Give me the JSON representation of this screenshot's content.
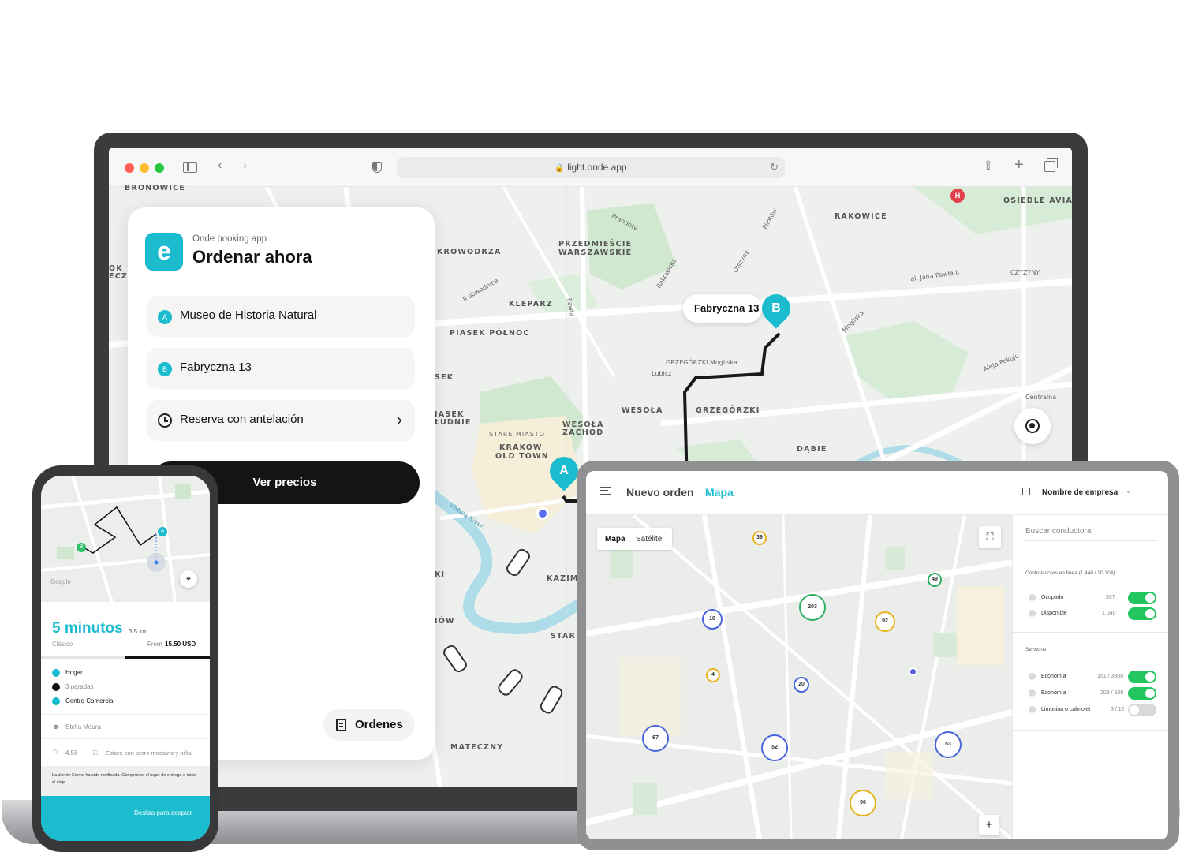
{
  "browser": {
    "url": "light.onde.app"
  },
  "map_labels": {
    "bronowice": "BRONOWICE",
    "krowodrza": "KROWODRZA",
    "przedmiescie": "PRZEDMIEŚCIE",
    "warszawskie": "WARSZAWSKIE",
    "rakowice": "RAKOWICE",
    "osiedle_avia": "OSIEDLE AVIA",
    "kleparz": "KLEPARZ",
    "piasek": "PIASEK PÓŁNOC",
    "grzegorzki_street": "GRZEGÓRZKI Mogilska",
    "grzegorzki": "GRZEGÓRZKI",
    "wesola": "WESOŁA",
    "wesola_zachod_1": "WESOŁA",
    "wesola_zachod_2": "ZACHÓD",
    "stare_miasto": "STARE MIASTO",
    "krakow": "KRAKÓW",
    "old_town": "OLD TOWN",
    "dabie": "DĄBIE",
    "kazim": "KAZIM",
    "mateczny": "MATECZNY",
    "czyzyny": "CZYŻYNY",
    "centralna": "Centralna",
    "prandoty": "Prandoty",
    "pilotow": "Pilotów",
    "olszyny": "Olszyny",
    "rakowicka": "Rakowicka",
    "mogilska": "Mogilska",
    "aleja_pokoju": "Aleja Pokoju",
    "lubicz": "Lubicz",
    "vistula": "Vistula River",
    "sek": "SEK",
    "piasek_ludnie_1": "IASEK",
    "piasek_ludnie_2": "ŁUDNIE",
    "ok": "OK",
    "ecze": "ECZE",
    "ki": "KI",
    "iow": "IÓW",
    "star": "STAR",
    "pawia": "Pawia",
    "jana_pawla": "al. Jana Pawła II",
    "obwodnica": "II obwodnica"
  },
  "booking": {
    "subtitle": "Onde booking app",
    "title": "Ordenar ahora",
    "logo_letter": "e",
    "origin_badge": "A",
    "origin": "Museo de Historia Natural",
    "dest_badge": "B",
    "destination": "Fabryczna 13",
    "schedule": "Reserva con antelación",
    "prices_button": "Ver precios",
    "orders_button": "Ordenes"
  },
  "markers": {
    "b_label": "Fabryczna 13",
    "b_letter": "B",
    "a_letter": "A",
    "hospital": "H"
  },
  "phone": {
    "google": "Google",
    "eta": "5 minutos",
    "distance": "3.5 km",
    "class": "Clásico",
    "from_label": "From",
    "price": "15.50 USD",
    "stop_home": "Hogar",
    "stops": "3 paradas",
    "stop_mall": "Centro Comercial",
    "driver": "Stella Moura",
    "rating": "4.58",
    "note": "Estaré con perro mediano y niña",
    "notice": "La cliente Emma ha sido notificada. Compruebe el lugar de entrega e inicio el viaje.",
    "slide": "Desliza para aceptar",
    "pin_a": "A",
    "pin_b": "B"
  },
  "tablet": {
    "title": "Nuevo orden",
    "active_tab": "Mapa",
    "company": "Nombre de empresa",
    "map_tab": "Mapa",
    "satellite_tab": "Satélite",
    "search_placeholder": "Buscar conductora",
    "online_header": "Controladores en línea (1,440 / 20,304)",
    "occupied": "Ocupado",
    "occupied_count": "357",
    "available": "Disponible",
    "available_count": "1,040",
    "services_header": "Servicios",
    "service_1": "Economía",
    "service_1_count": "151 / 3300",
    "service_2": "Economía",
    "service_2_count": "203 / 339",
    "service_3": "Limusina o cabriolet",
    "service_3_count": "3 / 12",
    "zoom_in": "+",
    "clusters": [
      "39",
      "49",
      "18",
      "203",
      "92",
      "4",
      "20",
      "67",
      "52",
      "53",
      "90"
    ]
  }
}
